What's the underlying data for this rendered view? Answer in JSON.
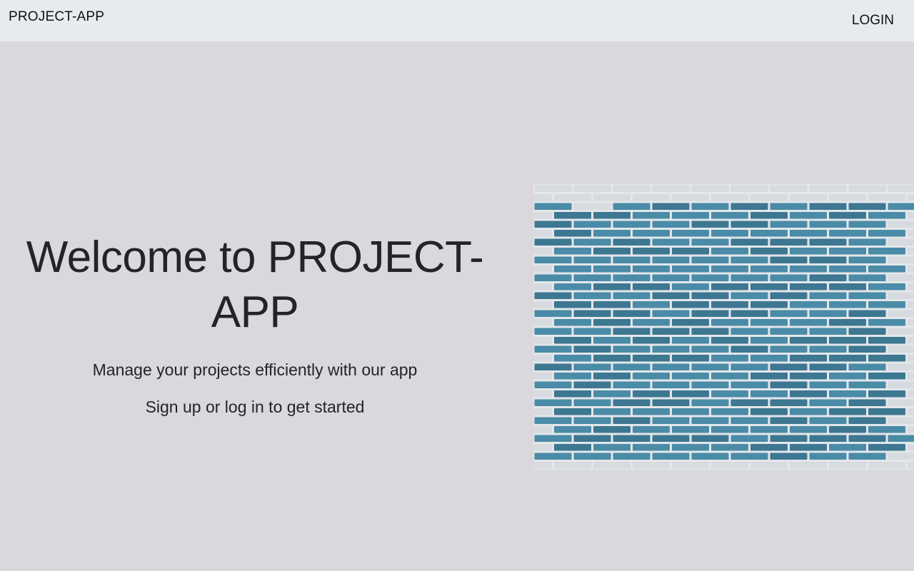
{
  "navbar": {
    "brand": "PROJECT-APP",
    "login_label": "LOGIN"
  },
  "hero": {
    "title": "Welcome to PROJECT-APP",
    "subtitle": "Manage your projects efficiently with our app",
    "cta_text": "Sign up or log in to get started",
    "image": {
      "semantic": "painted-brick-wall-image",
      "colors": {
        "paint": "#4a8ba7",
        "paint_dark": "#3d7791",
        "mortar": "#e3e6ea",
        "white_brick": "#d7dbe0"
      }
    }
  },
  "colors": {
    "page_bg": "#dad8dc",
    "navbar_bg": "#e7ebef",
    "text": "#222428"
  }
}
